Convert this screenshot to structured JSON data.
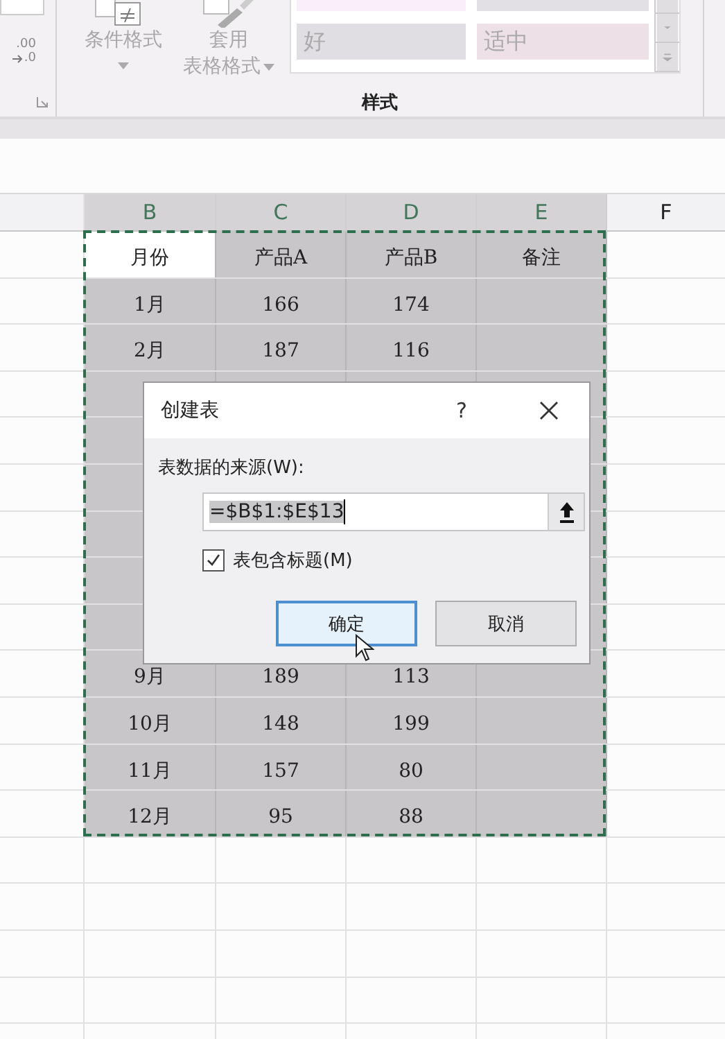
{
  "ribbon": {
    "decimal": {
      "top": ".00",
      "bottom": ".0"
    },
    "buttons": [
      {
        "kind": "conditional",
        "lines": [
          "条件格式"
        ]
      },
      {
        "kind": "table",
        "lines": [
          "套用",
          "表格格式"
        ]
      }
    ],
    "gallery": [
      {
        "color": "#fbeefb"
      },
      {
        "color": "#e3e0e5"
      },
      {
        "label": "好",
        "color": "#e1dee3"
      },
      {
        "label": "适中",
        "color": "#ede0e7"
      }
    ],
    "group_label": "样式"
  },
  "sheet": {
    "columns": [
      {
        "label": "B",
        "selected": true
      },
      {
        "label": "C",
        "selected": true
      },
      {
        "label": "D",
        "selected": true
      },
      {
        "label": "E",
        "selected": true
      },
      {
        "label": "F",
        "selected": false
      }
    ],
    "rows": [
      {
        "cells": [
          {
            "text": "月份",
            "active": true
          },
          {
            "text": "产品A",
            "active": false
          },
          {
            "text": "产品B",
            "active": false
          },
          {
            "text": "备注",
            "active": false
          }
        ]
      },
      {
        "cells": [
          "1月",
          "166",
          "174"
        ]
      },
      {
        "cells": [
          "2月",
          "187",
          "116"
        ]
      },
      {
        "covered": true
      },
      {
        "covered": true
      },
      {
        "covered": true
      },
      {
        "covered": true
      },
      {
        "covered": true
      },
      {
        "covered": true
      },
      {
        "cells": [
          "9月",
          "189",
          "113"
        ]
      },
      {
        "cells": [
          "10月",
          "148",
          "199"
        ]
      },
      {
        "cells": [
          "11月",
          "157",
          "80"
        ]
      },
      {
        "cells": [
          "12月",
          "95",
          "88"
        ]
      }
    ]
  },
  "dialog": {
    "title": "创建表",
    "help": "?",
    "source_label": "表数据的来源(W):",
    "range_value": "=$B$1:$E$13",
    "value_selected": true,
    "has_headers": {
      "label": "表包含标题(M)",
      "checked": true
    },
    "buttons": [
      {
        "label": "确定",
        "default": true
      },
      {
        "label": "取消",
        "default": false
      }
    ]
  }
}
